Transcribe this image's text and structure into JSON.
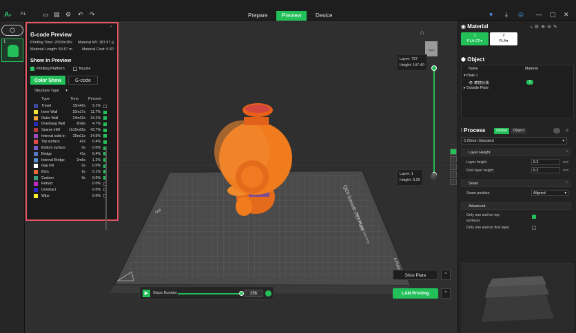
{
  "topbar": {
    "menu": "F1.",
    "tabs": [
      {
        "label": "Prepare",
        "active": false
      },
      {
        "label": "Preview",
        "active": true
      },
      {
        "label": "Device",
        "active": false
      }
    ]
  },
  "plates": {
    "first_number": "1"
  },
  "gcode_preview": {
    "title": "G-code Preview",
    "printing_time": "Printing Time: 2h53m38s",
    "material_wt": "Material Wt: 181.97 g",
    "material_length": "Material Length: 59.57 m",
    "material_cost": "Material Cost: 5.82",
    "show_in_preview": "Show in Preview",
    "printing_platform": "Printing Platform",
    "nozzle": "Nozzle",
    "color_show": "Color Show",
    "gcode": "G-code",
    "structure_type": "Structure Type",
    "col_type": "Type",
    "col_time": "Time",
    "col_percent": "Percent",
    "features": [
      {
        "name": "Travel",
        "time": "15m45s",
        "pct": "9.1%",
        "color": "#3c4a9b",
        "checked": false
      },
      {
        "name": "Inner Wall",
        "time": "20m17s",
        "pct": "11.7%",
        "color": "#f2df3b",
        "checked": true
      },
      {
        "name": "Outer Wall",
        "time": "24m32s",
        "pct": "14.1%",
        "color": "#f5a23a",
        "checked": true
      },
      {
        "name": "Overhang Wall",
        "time": "8m8s",
        "pct": "4.7%",
        "color": "#2a2ab0",
        "checked": true
      },
      {
        "name": "Sparse infill",
        "time": "1h15m55s",
        "pct": "43.7%",
        "color": "#b73b3b",
        "checked": true
      },
      {
        "name": "Internal solid in",
        "time": "25m11s",
        "pct": "14.5%",
        "color": "#9b4fbf",
        "checked": true
      },
      {
        "name": "Top surface",
        "time": "42s",
        "pct": "0.4%",
        "color": "#e64b4b",
        "checked": true
      },
      {
        "name": "Bottom surface",
        "time": "0s",
        "pct": "0.0%",
        "color": "#7a5fcf",
        "checked": true
      },
      {
        "name": "Bridge",
        "time": "41s",
        "pct": "0.4%",
        "color": "#5577bb",
        "checked": true
      },
      {
        "name": "Internal Bridge",
        "time": "2m6s",
        "pct": "1.2%",
        "color": "#5a8ccf",
        "checked": true
      },
      {
        "name": "Gap Fill",
        "time": "0s",
        "pct": "0.0%",
        "color": "#ffffff",
        "checked": true
      },
      {
        "name": "Brim",
        "time": "6s",
        "pct": "0.1%",
        "color": "#e46a3a",
        "checked": true
      },
      {
        "name": "Custom",
        "time": "0s",
        "pct": "0.0%",
        "color": "#40a080",
        "checked": true
      },
      {
        "name": "Retract",
        "time": "",
        "pct": "0.0%",
        "color": "#c42bc4",
        "checked": false
      },
      {
        "name": "Unretract",
        "time": "",
        "pct": "0.0%",
        "color": "#2b2bd0",
        "checked": false
      },
      {
        "name": "Wipe",
        "time": "",
        "pct": "0.0%",
        "color": "#f2f230",
        "checked": false
      }
    ]
  },
  "layer_top": {
    "layer": "Layer: 737",
    "height": "Height: 147.40"
  },
  "layer_bottom": {
    "layer": "Layer: 1",
    "height": "Height: 0.20"
  },
  "view_cube": "Right",
  "bed_text": {
    "brand": "Qidi",
    "plate": "QIDI Smooth PEI Plate",
    "side": "Smooth side use only",
    "front": "A Plate"
  },
  "steps": {
    "label": "Steps Number",
    "value": "256"
  },
  "buttons": {
    "slice_plate": "Slice Plate",
    "lan_printing": "LAN Printing"
  },
  "material": {
    "title": "Material",
    "slots": [
      {
        "num": "1",
        "name": "PLA-CF▾",
        "color": "#23c05a"
      },
      {
        "num": "2",
        "name": "PLA▾",
        "color": "#ffffff"
      }
    ]
  },
  "object": {
    "title": "Object",
    "col_name": "Name",
    "col_material": "Material",
    "plate": "Plate 1",
    "item": "藏镜玩偶",
    "item_material": "1",
    "outside": "Outside Plate"
  },
  "process": {
    "title": "Process",
    "global": "Global",
    "object": "Object",
    "preset": "0.20mm Standard",
    "layer_height_group": "Layer Height",
    "layer_height": "Layer height",
    "layer_height_val": "0.2",
    "first_layer_height": "First layer height",
    "first_layer_height_val": "0.2",
    "unit": "mm",
    "seam_group": "Seam",
    "seam_position": "Seam position",
    "seam_position_val": "Aligned",
    "advanced_group": "Advanced",
    "one_wall_top": "Only one wall on top",
    "one_wall_top2": "surfaces",
    "one_wall_first": "Only one wall on first layer"
  },
  "colors": {
    "accent": "#23c05a",
    "highlight_border": "#e05561",
    "model": "#f07c1e"
  }
}
